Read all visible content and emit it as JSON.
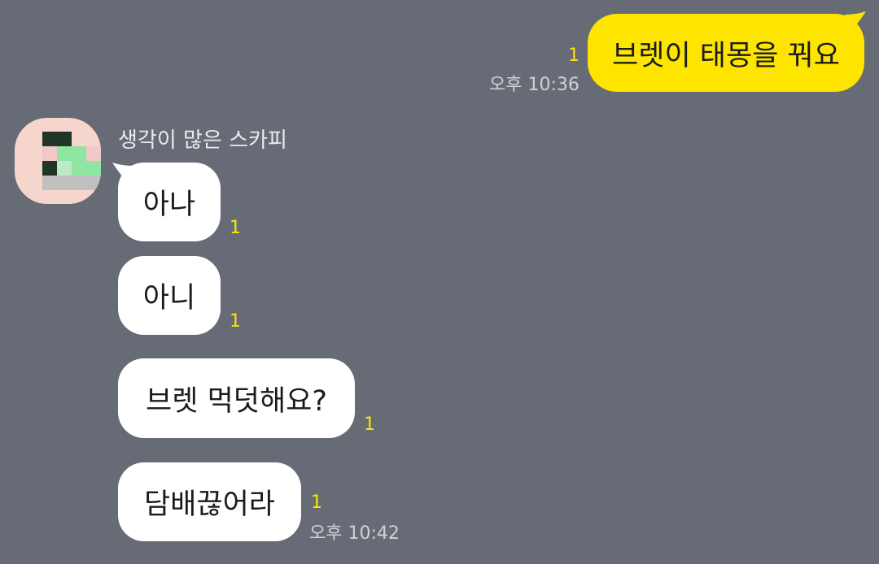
{
  "colors": {
    "background": "#666b75",
    "my_bubble": "#fee500",
    "their_bubble": "#ffffff",
    "unread": "#fee500",
    "time": "#cfd1d6",
    "sender_name": "#e9eaee"
  },
  "outgoing": [
    {
      "text": "브렛이 태몽을 꿔요",
      "unread": "1",
      "time": "오후 10:36"
    }
  ],
  "sender": {
    "name": "생각이 많은 스카피",
    "avatar_icon": "pixelated-avatar-icon"
  },
  "incoming": [
    {
      "text": "아나",
      "unread": "1"
    },
    {
      "text": "아니",
      "unread": "1"
    },
    {
      "text": "브렛 먹덧해요?",
      "unread": "1"
    },
    {
      "text": "담배끊어라",
      "unread": "1",
      "time": "오후 10:42"
    }
  ]
}
